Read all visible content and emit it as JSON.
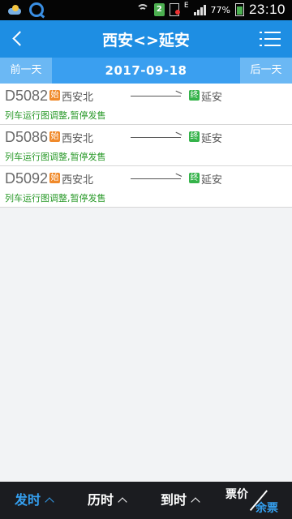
{
  "status_bar": {
    "badge": "2",
    "network_type": "E",
    "battery_percent": "77%",
    "time": "23:10"
  },
  "header": {
    "title": "西安<>延安"
  },
  "date_bar": {
    "prev_label": "前一天",
    "date": "2017-09-18",
    "next_label": "后一天"
  },
  "trains": [
    {
      "number": "D5082",
      "start_tag": "始",
      "from": "西安北",
      "end_tag": "终",
      "to": "延安",
      "note": "列车运行图调整,暂停发售"
    },
    {
      "number": "D5086",
      "start_tag": "始",
      "from": "西安北",
      "end_tag": "终",
      "to": "延安",
      "note": "列车运行图调整,暂停发售"
    },
    {
      "number": "D5092",
      "start_tag": "始",
      "from": "西安北",
      "end_tag": "终",
      "to": "延安",
      "note": "列车运行图调整,暂停发售"
    }
  ],
  "bottom_bar": {
    "sort_depart": "发时",
    "sort_duration": "历时",
    "sort_arrive": "到时",
    "price_label": "票价",
    "tickets_label": "余票"
  },
  "colors": {
    "header_blue": "#1e8ee3",
    "date_blue": "#3a9ff0",
    "note_green": "#2a9a2a",
    "start_tag_orange": "#f08a2b",
    "end_tag_green": "#35b34a",
    "active_sort_blue": "#35a0f0"
  }
}
